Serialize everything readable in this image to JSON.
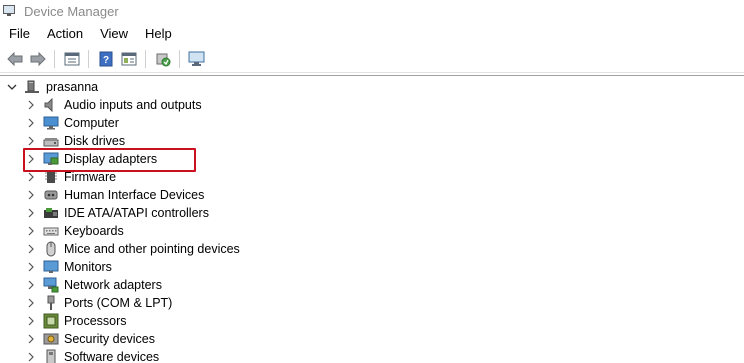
{
  "window": {
    "title": "Device Manager"
  },
  "menu": [
    "File",
    "Action",
    "View",
    "Help"
  ],
  "toolbar": [
    "back-icon",
    "forward-icon",
    "properties-icon",
    "help-icon",
    "view-icon",
    "update-driver-icon",
    "scan-hardware-icon"
  ],
  "tree": {
    "root": "prasanna",
    "items": [
      {
        "label": "Audio inputs and outputs",
        "icon": "speaker-icon"
      },
      {
        "label": "Computer",
        "icon": "computer-icon"
      },
      {
        "label": "Disk drives",
        "icon": "disk-drive-icon"
      },
      {
        "label": "Display adapters",
        "icon": "display-adapter-icon"
      },
      {
        "label": "Firmware",
        "icon": "firmware-icon"
      },
      {
        "label": "Human Interface Devices",
        "icon": "hid-icon"
      },
      {
        "label": "IDE ATA/ATAPI controllers",
        "icon": "ide-controller-icon"
      },
      {
        "label": "Keyboards",
        "icon": "keyboard-icon"
      },
      {
        "label": "Mice and other pointing devices",
        "icon": "mouse-icon"
      },
      {
        "label": "Monitors",
        "icon": "monitor-icon"
      },
      {
        "label": "Network adapters",
        "icon": "network-adapter-icon"
      },
      {
        "label": "Ports (COM & LPT)",
        "icon": "port-icon"
      },
      {
        "label": "Processors",
        "icon": "processor-icon"
      },
      {
        "label": "Security devices",
        "icon": "security-device-icon"
      },
      {
        "label": "Software devices",
        "icon": "software-device-icon"
      }
    ]
  },
  "highlight": {
    "target": "Display adapters",
    "color": "#c8101e"
  }
}
